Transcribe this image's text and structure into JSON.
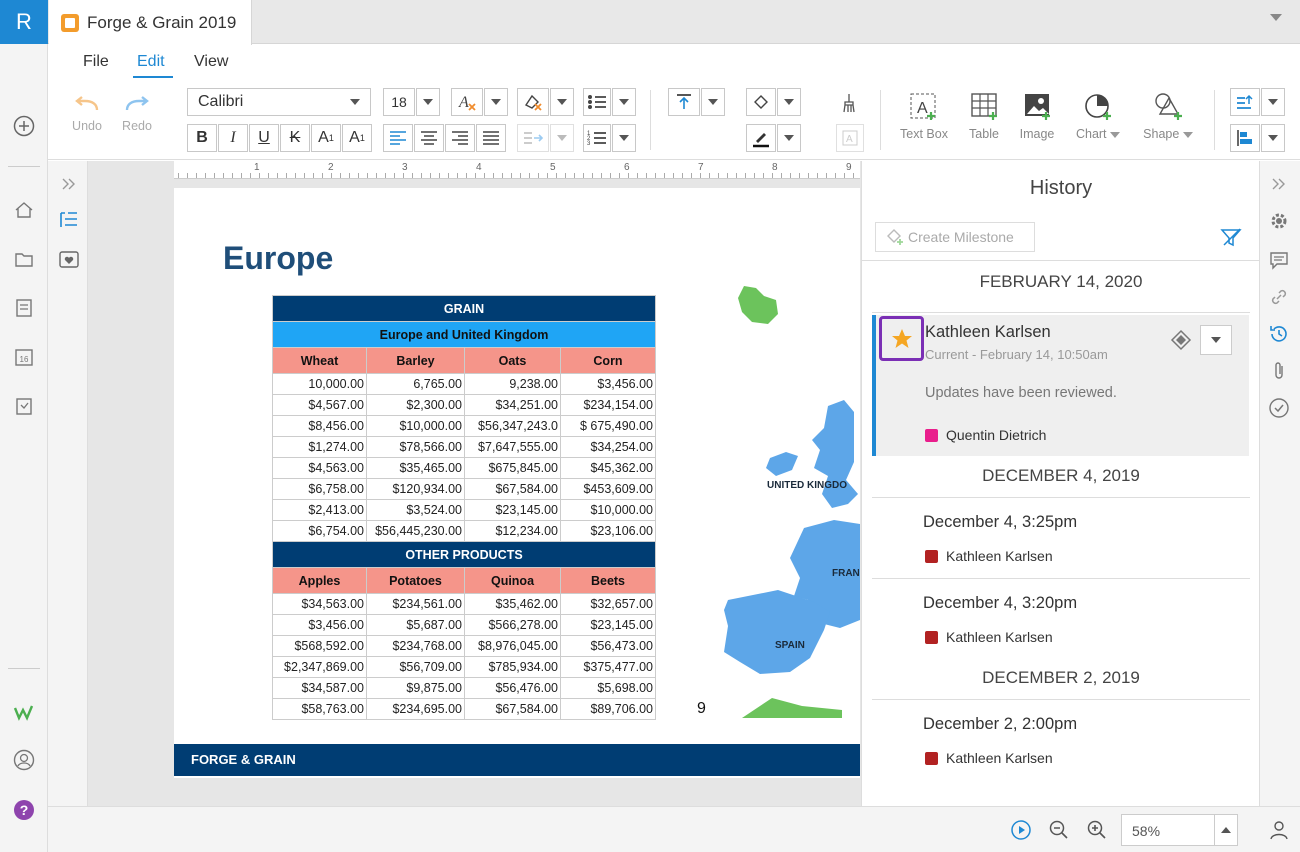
{
  "app": {
    "logo": "R"
  },
  "tab": {
    "title": "Forge & Grain 2019"
  },
  "menu": {
    "file": "File",
    "edit": "Edit",
    "view": "View"
  },
  "ribbon": {
    "undo": "Undo",
    "redo": "Redo",
    "font": "Calibri",
    "font_size": "18",
    "bold": "B",
    "italic": "I",
    "underline": "U",
    "strike": "K",
    "superscript": "A",
    "subscript": "A",
    "textbox": "Text Box",
    "table": "Table",
    "image": "Image",
    "chart": "Chart",
    "shape": "Shape"
  },
  "ruler": {
    "marks": [
      "1",
      "2",
      "3",
      "4",
      "5",
      "6",
      "7",
      "8",
      "9"
    ]
  },
  "slide": {
    "title": "Europe",
    "footer": "FORGE & GRAIN",
    "page_number": "9",
    "map_labels": {
      "uk": "UNITED KINGDO",
      "france": "FRAN",
      "spain": "SPAIN"
    },
    "grain_table": {
      "title": "GRAIN",
      "subtitle": "Europe and United Kingdom",
      "headers": [
        "Wheat",
        "Barley",
        "Oats",
        "Corn"
      ],
      "rows": [
        [
          "10,000.00",
          "6,765.00",
          "9,238.00",
          "$3,456.00"
        ],
        [
          "$4,567.00",
          "$2,300.00",
          "$34,251.00",
          "$234,154.00"
        ],
        [
          "$8,456.00",
          "$10,000.00",
          "$56,347,243.0",
          "$ 675,490.00"
        ],
        [
          "$1,274.00",
          "$78,566.00",
          "$7,647,555.00",
          "$34,254.00"
        ],
        [
          "$4,563.00",
          "$35,465.00",
          "$675,845.00",
          "$45,362.00"
        ],
        [
          "$6,758.00",
          "$120,934.00",
          "$67,584.00",
          "$453,609.00"
        ],
        [
          "$2,413.00",
          "$3,524.00",
          "$23,145.00",
          "$10,000.00"
        ],
        [
          "$6,754.00",
          "$56,445,230.00",
          "$12,234.00",
          "$23,106.00"
        ]
      ]
    },
    "other_table": {
      "title": "OTHER PRODUCTS",
      "headers": [
        "Apples",
        "Potatoes",
        "Quinoa",
        "Beets"
      ],
      "rows": [
        [
          "$34,563.00",
          "$234,561.00",
          "$35,462.00",
          "$32,657.00"
        ],
        [
          "$3,456.00",
          "$5,687.00",
          "$566,278.00",
          "$23,145.00"
        ],
        [
          "$568,592.00",
          "$234,768.00",
          "$8,976,045.00",
          "$56,473.00"
        ],
        [
          "$2,347,869.00",
          "$56,709.00",
          "$785,934.00",
          "$375,477.00"
        ],
        [
          "$34,587.00",
          "$9,875.00",
          "$56,476.00",
          "$5,698.00"
        ],
        [
          "$58,763.00",
          "$234,695.00",
          "$67,584.00",
          "$89,706.00"
        ]
      ]
    }
  },
  "history": {
    "title": "History",
    "create_milestone": "Create Milestone",
    "groups": [
      {
        "date": "FEBRUARY 14, 2020"
      },
      {
        "date": "DECEMBER 4, 2019"
      },
      {
        "date": "DECEMBER 2, 2019"
      }
    ],
    "current": {
      "author": "Kathleen Karlsen",
      "subtitle": "Current - February 14, 10:50am",
      "message": "Updates have been reviewed.",
      "collaborator": "Quentin Dietrich",
      "collaborator_color": "#e91e8c"
    },
    "entries": [
      {
        "time": "December 4, 3:25pm",
        "author": "Kathleen Karlsen",
        "color": "#b22222"
      },
      {
        "time": "December 4, 3:20pm",
        "author": "Kathleen Karlsen",
        "color": "#b22222"
      },
      {
        "time": "December 2, 2:00pm",
        "author": "Kathleen Karlsen",
        "color": "#b22222"
      }
    ]
  },
  "status": {
    "zoom": "58%"
  },
  "colors": {
    "accent": "#1e88d3",
    "navy": "#003d73",
    "star": "#f5a623",
    "highlight": "#7b2fb5"
  }
}
